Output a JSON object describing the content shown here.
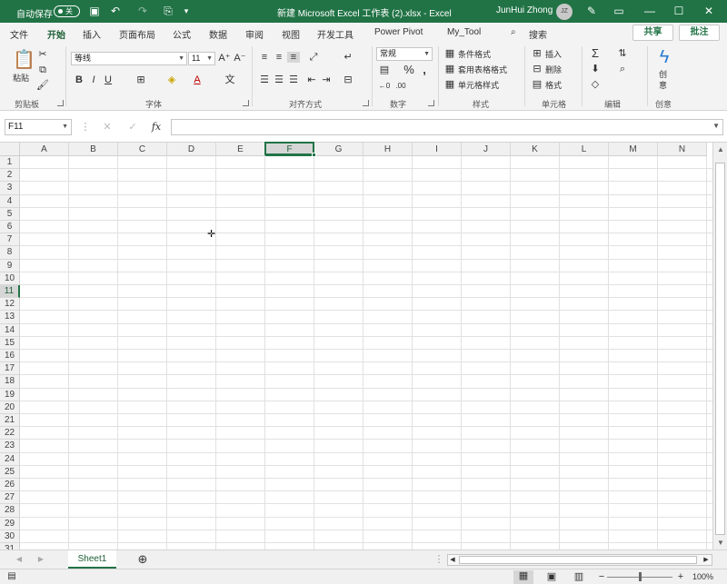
{
  "titlebar": {
    "autosave_label": "自动保存",
    "autosave_state": "关",
    "title": "新建 Microsoft Excel 工作表 (2).xlsx  -  Excel",
    "user": "JunHui Zhong",
    "avatar_initials": "JZ"
  },
  "tabs": [
    "文件",
    "开始",
    "插入",
    "页面布局",
    "公式",
    "数据",
    "审阅",
    "视图",
    "开发工具",
    "Power Pivot",
    "My_Tool"
  ],
  "search_label": "搜索",
  "share_label": "共享",
  "comment_label": "批注",
  "ribbon": {
    "clipboard": {
      "paste": "粘贴",
      "label": "剪贴板"
    },
    "font": {
      "name": "等线",
      "size": "11",
      "label": "字体"
    },
    "alignment": {
      "label": "对齐方式"
    },
    "number": {
      "format": "常规",
      "label": "数字"
    },
    "styles": {
      "cond": "条件格式",
      "table": "套用表格格式",
      "cell": "单元格样式",
      "label": "样式"
    },
    "cells": {
      "insert": "插入",
      "delete": "删除",
      "format": "格式",
      "label": "单元格"
    },
    "editing": {
      "label": "编辑"
    },
    "creative": {
      "button": "创意",
      "label": "创意"
    }
  },
  "namebox": "F11",
  "columns": [
    "A",
    "B",
    "C",
    "D",
    "E",
    "F",
    "G",
    "H",
    "I",
    "J",
    "K",
    "L",
    "M",
    "N"
  ],
  "rows": [
    "1",
    "2",
    "3",
    "4",
    "5",
    "6",
    "7",
    "8",
    "9",
    "10",
    "11",
    "12",
    "13",
    "14",
    "15",
    "16",
    "17",
    "18",
    "19",
    "20",
    "21",
    "22",
    "23",
    "24",
    "25",
    "26",
    "27",
    "28",
    "29",
    "30",
    "31"
  ],
  "selected": {
    "column": "F",
    "row": "11"
  },
  "sheet": "Sheet1",
  "zoom": "100%",
  "colors": {
    "accent": "#217346"
  }
}
